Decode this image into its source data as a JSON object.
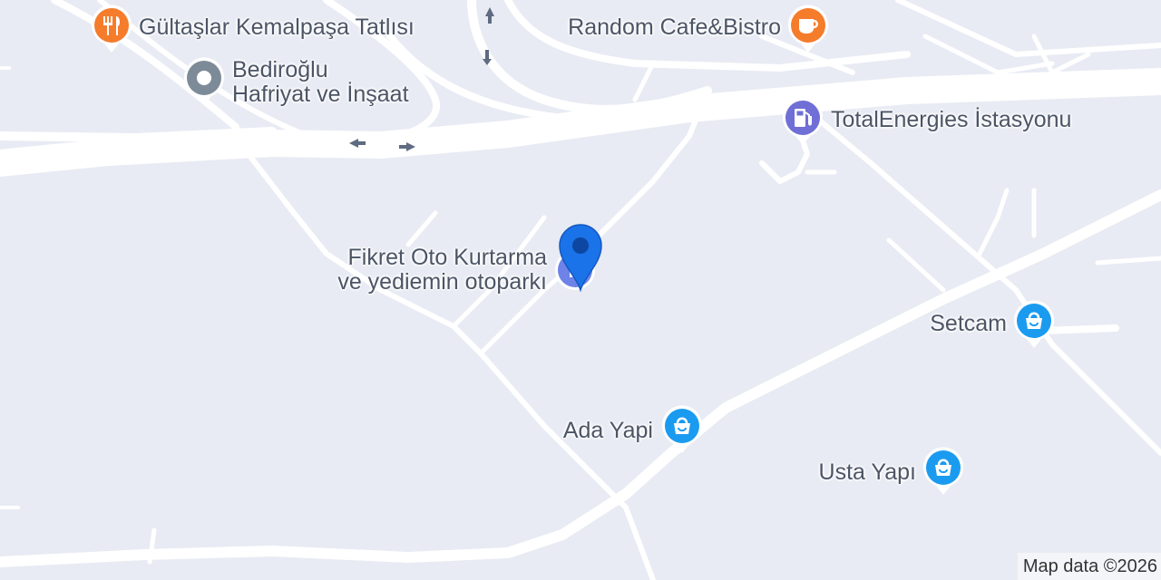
{
  "map": {
    "background": "#e8ebf3",
    "road_color": "#ffffff",
    "pois": [
      {
        "id": "gultaslar",
        "name": "Gültaşlar Kemalpaşa Tatlısı",
        "category": "restaurant",
        "icon": "fork-knife-icon",
        "color": "#f57c2b"
      },
      {
        "id": "random-cafe",
        "name": "Random Cafe&Bistro",
        "category": "cafe",
        "icon": "coffee-cup-icon",
        "color": "#f57c2b"
      },
      {
        "id": "bediroglu",
        "name_line1": "Bediroğlu",
        "name_line2": "Hafriyat ve İnşaat",
        "category": "generic",
        "icon": "dot-icon",
        "color": "#7d8b99"
      },
      {
        "id": "totalenergies",
        "name": "TotalEnergies İstasyonu",
        "category": "gas-station",
        "icon": "fuel-pump-icon",
        "color": "#6f6fd6"
      },
      {
        "id": "fikret",
        "name_line1": "Fikret Oto Kurtarma",
        "name_line2": "ve yediemin otoparkı",
        "category": "parking",
        "icon": "parking-icon",
        "color": "#6e83e8"
      },
      {
        "id": "setcam",
        "name": "Setcam",
        "category": "shopping",
        "icon": "shopping-bag-icon",
        "color": "#1a9bf0"
      },
      {
        "id": "ada-yapi",
        "name": "Ada Yapi",
        "category": "shopping",
        "icon": "shopping-bag-icon",
        "color": "#1a9bf0"
      },
      {
        "id": "usta-yapi",
        "name": "Usta Yapı",
        "category": "shopping",
        "icon": "shopping-bag-icon",
        "color": "#1a9bf0"
      }
    ],
    "selected_marker": {
      "icon": "map-marker-icon",
      "color": "#1a73e8"
    },
    "attribution": "Map data ©2026"
  }
}
